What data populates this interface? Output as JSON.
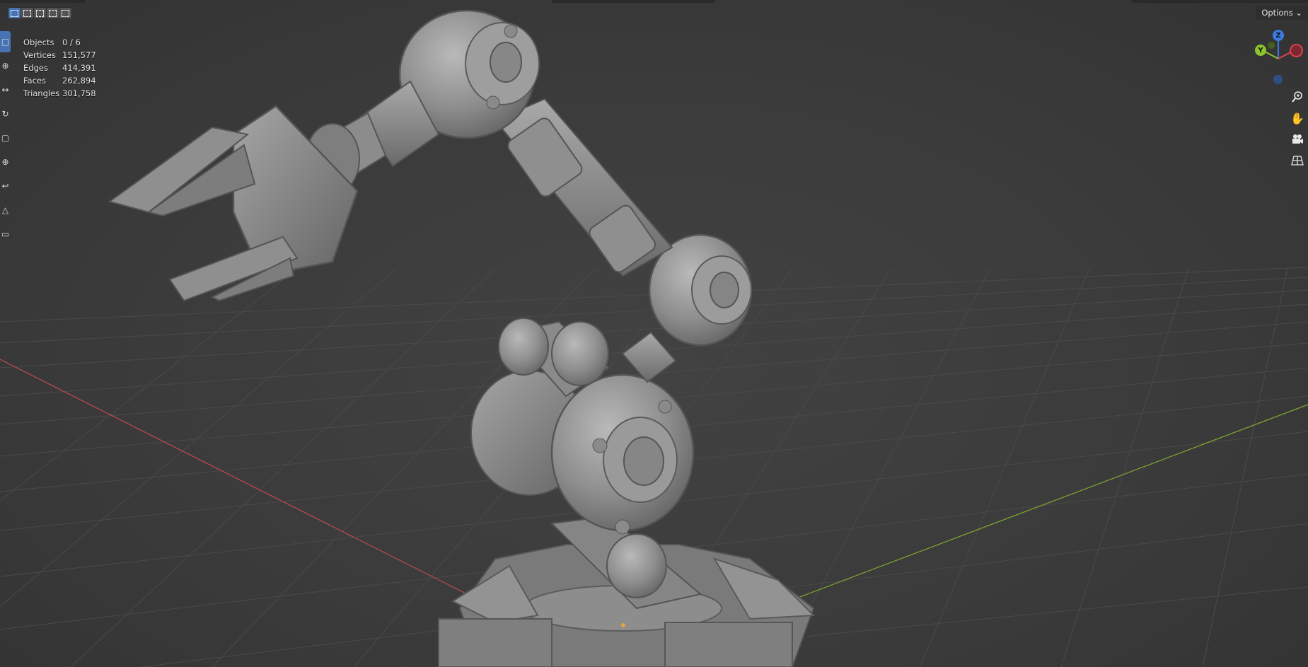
{
  "header": {
    "options_label": "Options"
  },
  "stats": [
    {
      "label": "Objects",
      "value": "0 / 6"
    },
    {
      "label": "Vertices",
      "value": "151,577"
    },
    {
      "label": "Edges",
      "value": "414,391"
    },
    {
      "label": "Faces",
      "value": "262,894"
    },
    {
      "label": "Triangles",
      "value": "301,758"
    }
  ],
  "gizmo": {
    "z_label": "Z",
    "y_label": "Y",
    "x_color": "#e04050",
    "y_color": "#8cc42e",
    "z_color": "#3b7be0"
  },
  "tools": [
    {
      "name": "select-box-tool",
      "icon": "dashed-box-icon"
    },
    {
      "name": "cursor-tool",
      "icon": "cursor-icon"
    },
    {
      "name": "move-tool",
      "icon": "move-icon"
    },
    {
      "name": "rotate-tool",
      "icon": "rotate-icon"
    },
    {
      "name": "scale-tool",
      "icon": "scale-icon"
    },
    {
      "name": "transform-tool",
      "icon": "transform-icon"
    },
    {
      "name": "annotate-tool",
      "icon": "annotate-icon"
    },
    {
      "name": "measure-tool",
      "icon": "measure-icon"
    },
    {
      "name": "add-cube-tool",
      "icon": "cube-icon"
    }
  ],
  "colors": {
    "viewport_bg": "#3d3d3d",
    "grid_line": "#4a4a4a",
    "x_axis": "#b8484e",
    "y_axis": "#7aa132",
    "active_tool": "#4772b3",
    "model": "#8c8c8c"
  }
}
